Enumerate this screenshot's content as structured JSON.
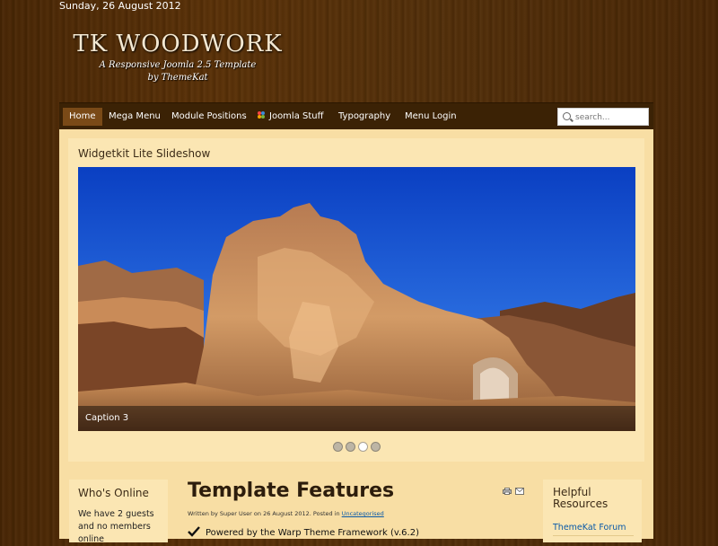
{
  "header": {
    "date": "Sunday, 26 August 2012",
    "site_title": "TK WOODWORK",
    "tagline_line1": "A Responsive Joomla 2.5 Template",
    "tagline_line2": "by ThemeKat"
  },
  "nav": {
    "items": [
      {
        "label": "Home",
        "active": true
      },
      {
        "label": "Mega Menu"
      },
      {
        "label": "Module Positions"
      },
      {
        "label": "Joomla Stuff",
        "icon": "joomla-icon"
      },
      {
        "label": "Typography"
      },
      {
        "label": "Menu Login"
      }
    ],
    "search_placeholder": "search..."
  },
  "slideshow": {
    "heading": "Widgetkit Lite Slideshow",
    "caption": "Caption 3",
    "slide_count": 4,
    "active_index": 2
  },
  "left_module": {
    "heading": "Who's Online",
    "text": "We have 2 guests and no members online"
  },
  "article": {
    "title": "Template Features",
    "meta_prefix": "Written by Super User on 26 August 2012. Posted in ",
    "meta_category": "Uncategorised",
    "feature_1": "Powered by the Warp Theme Framework (v.6.2)"
  },
  "right_module": {
    "heading": "Helpful Resources",
    "link_1": "ThemeKat Forum"
  },
  "colors": {
    "content_bg": "#f8dea4",
    "nav_bg": "#3b2205",
    "link": "#0a5aa8"
  }
}
